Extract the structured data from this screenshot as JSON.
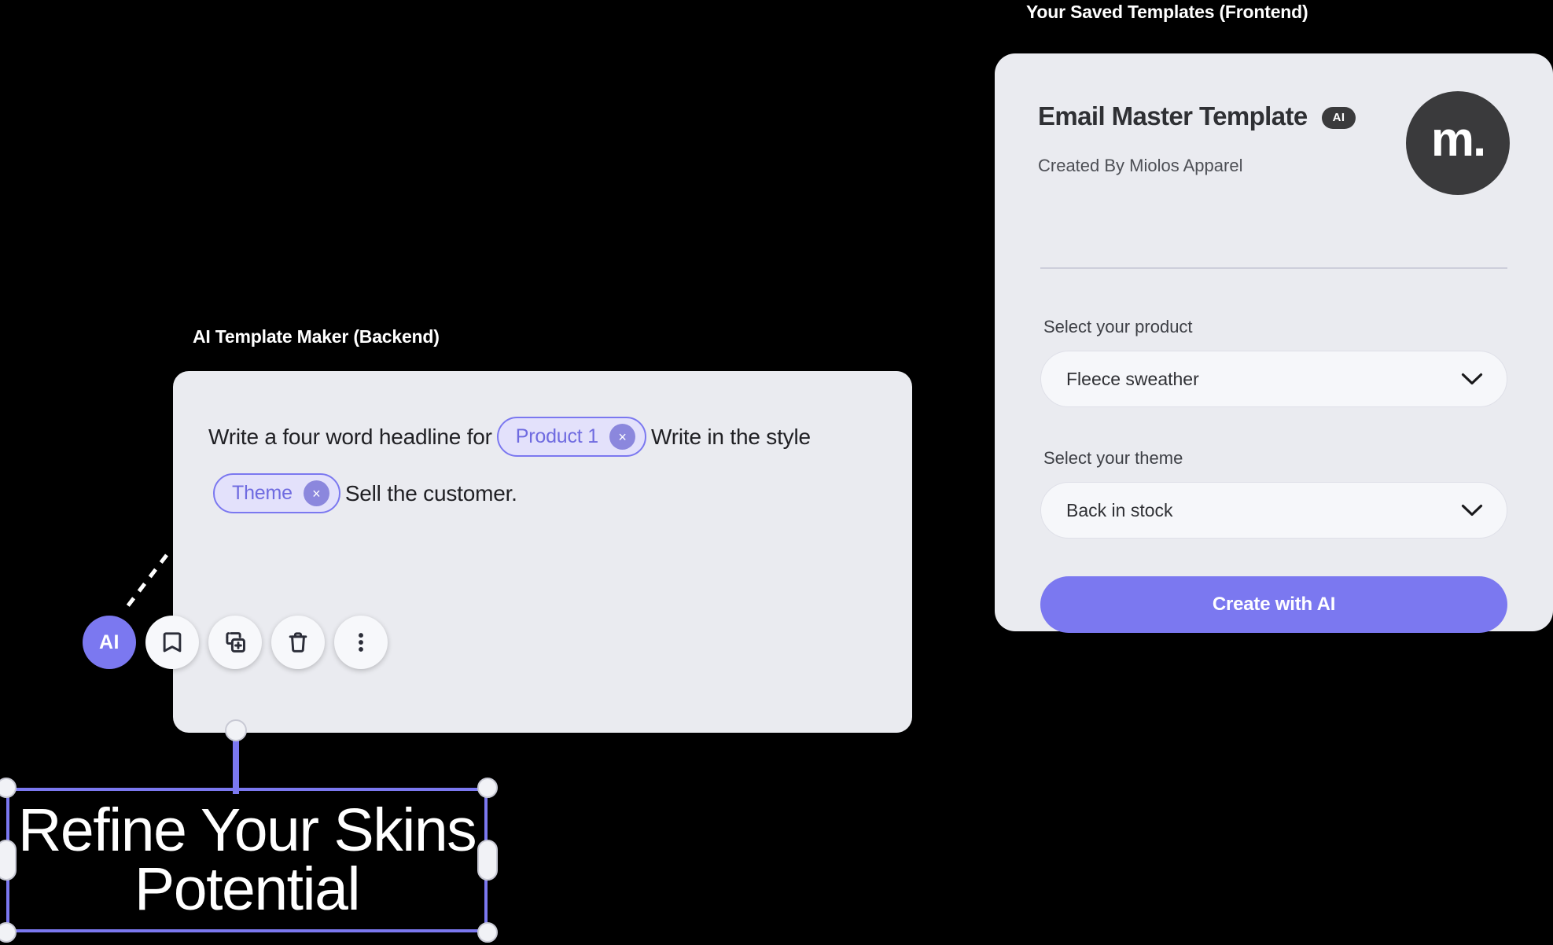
{
  "canvas": {
    "background": "#000000",
    "accent": "#7b78f0",
    "card_bg": "#eaebf0",
    "dark": "#3a3a3c"
  },
  "frontend": {
    "section_label": "Your Saved Templates (Frontend)",
    "title": "Email Master Template",
    "ai_badge": "AI",
    "subtitle": "Created By Miolos Apparel",
    "avatar_logo": "m.",
    "fields": [
      {
        "label": "Select your product",
        "value": "Fleece sweather",
        "icon": "chevron-down-icon"
      },
      {
        "label": "Select your theme",
        "value": "Back in stock",
        "icon": "chevron-down-icon"
      }
    ],
    "primary_button": "Create with AI"
  },
  "backend": {
    "section_label": "AI Template Maker (Backend)",
    "prompt": {
      "segment_1": "Write a four word headline for",
      "chip_1": {
        "label": "Product 1",
        "remove": "×"
      },
      "segment_2": "Write in the style",
      "chip_2": {
        "label": "Theme",
        "remove": "×"
      },
      "segment_3": "Sell the customer."
    },
    "toolbar": [
      {
        "name": "ai-button",
        "label": "AI"
      },
      {
        "name": "bookmark-button",
        "label": ""
      },
      {
        "name": "duplicate-button",
        "label": ""
      },
      {
        "name": "delete-button",
        "label": ""
      },
      {
        "name": "more-options-button",
        "label": ""
      }
    ]
  },
  "selected_object": {
    "text": "Refine Your Skins\nPotential"
  }
}
